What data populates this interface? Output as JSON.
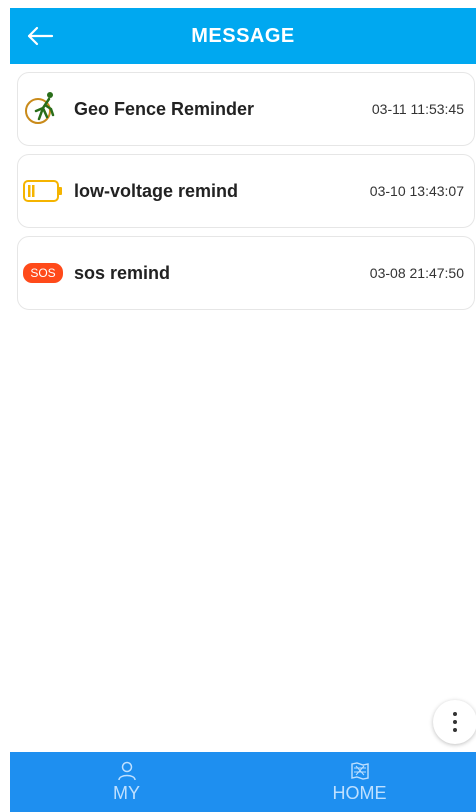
{
  "header": {
    "title": "MESSAGE",
    "back_icon": "arrow-left-icon"
  },
  "messages": [
    {
      "title": "Geo Fence Reminder",
      "time": "03-11 11:53:45",
      "icon": "geo-fence-runner-icon"
    },
    {
      "title": "low-voltage remind",
      "time": "03-10 13:43:07",
      "icon": "battery-low-icon"
    },
    {
      "title": "sos remind",
      "time": "03-08 21:47:50",
      "icon": "sos-badge-icon",
      "badge": "SOS"
    }
  ],
  "more_button": {
    "icon": "more-vertical-icon"
  },
  "tabbar": {
    "tabs": [
      {
        "label": "MY",
        "icon": "person-icon"
      },
      {
        "label": "HOME",
        "icon": "map-icon"
      }
    ]
  },
  "colors": {
    "header": "#00a8f0",
    "tabbar": "#1e8ff0",
    "tab_label": "#bfe0ff",
    "sos": "#ff4a1a",
    "battery": "#f5b400",
    "geo": "#c98a1a"
  }
}
